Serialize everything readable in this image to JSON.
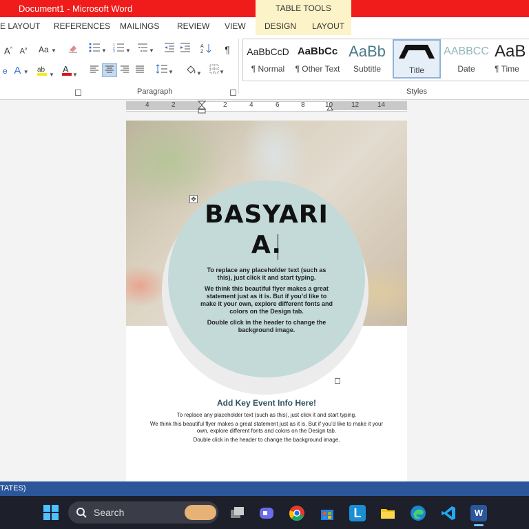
{
  "window": {
    "title": "Document1  -  Microsoft Word",
    "contextual_group": "TABLE TOOLS"
  },
  "tabs": [
    {
      "label": "E LAYOUT"
    },
    {
      "label": "REFERENCES"
    },
    {
      "label": "MAILINGS"
    },
    {
      "label": "REVIEW"
    },
    {
      "label": "VIEW"
    },
    {
      "label": "DESIGN"
    },
    {
      "label": "LAYOUT"
    }
  ],
  "ribbon": {
    "font_grow": "A",
    "font_shrink": "A",
    "change_case": "Aa",
    "paragraph_mark": "¶",
    "paragraph_group_label": "Paragraph",
    "styles_group_label": "Styles",
    "styles": [
      {
        "preview": "AaBbCcD",
        "name": "¶ Normal"
      },
      {
        "preview": "AaBbCc",
        "name": "¶ Other Text"
      },
      {
        "preview": "AaBb",
        "name": "Subtitle"
      },
      {
        "preview": "",
        "name": "Title"
      },
      {
        "preview": "AABBCC",
        "name": "Date"
      },
      {
        "preview": "AaB",
        "name": "¶ Time"
      }
    ]
  },
  "ruler": {
    "labels": [
      "4",
      "2",
      "2",
      "4",
      "6",
      "8",
      "10",
      "12",
      "14"
    ]
  },
  "document": {
    "title": "BASYARI A.",
    "title_line1": "BASYARI",
    "title_line2": "A.",
    "circle_paragraphs": [
      "To replace any placeholder text (such as this), just click it and start typing.",
      "We think this beautiful flyer makes a great statement just as it is.  But if you’d like to make it your own, explore different fonts and colors on the Design tab.",
      "Double click in the header to change the background image."
    ],
    "event_heading": "Add Key Event Info Here!",
    "event_paragraphs": [
      "To replace any placeholder text (such as this), just click it and start typing.",
      "We think this beautiful flyer makes a great statement just as it is.  But if you’d like to make it your own, explore different fonts and colors on the Design tab.",
      "Double click in the header to change the background image."
    ]
  },
  "statusbar": {
    "text": "TATES)"
  },
  "taskbar": {
    "search_label": "Search",
    "apps": [
      "start-icon",
      "task-view-icon",
      "chat-icon",
      "chrome-icon",
      "store-icon",
      "l-app-icon",
      "file-explorer-icon",
      "edge-icon",
      "vscode-icon",
      "word-icon"
    ]
  },
  "colors": {
    "title_bar": "#f01c1c",
    "contextual_tab": "#fdf3c8",
    "circle": "#c3dad9",
    "status_bar": "#2b579a",
    "event_heading": "#2f5061"
  }
}
